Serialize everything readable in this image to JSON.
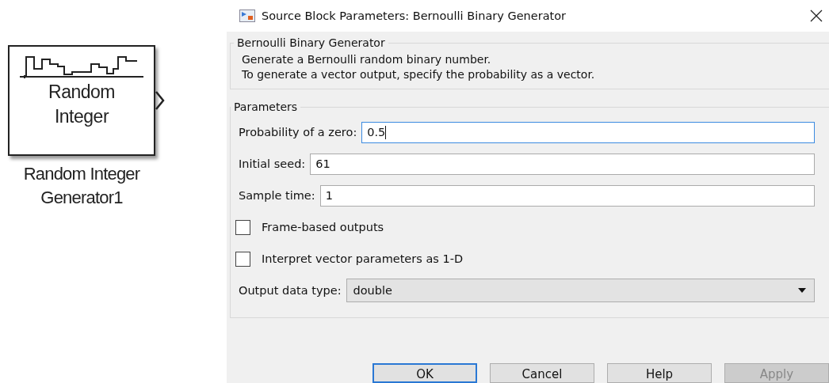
{
  "block": {
    "lines": [
      "Random",
      "Integer"
    ],
    "label_lines": [
      "Random Integer",
      "Generator1"
    ]
  },
  "window": {
    "title": "Source Block Parameters: Bernoulli Binary Generator"
  },
  "description": {
    "title": "Bernoulli Binary Generator",
    "lines": [
      "Generate a Bernoulli random binary number.",
      "To generate a vector output, specify the probability as a vector."
    ]
  },
  "parameters": {
    "title": "Parameters",
    "items": [
      {
        "kind": "text",
        "label": "Probability of a zero:",
        "value": "0.5",
        "focused": true
      },
      {
        "kind": "text",
        "label": "Initial seed:",
        "value": "61",
        "focused": false
      },
      {
        "kind": "text",
        "label": "Sample time:",
        "value": "1",
        "focused": false
      },
      {
        "kind": "checkbox",
        "label": "Frame-based outputs",
        "checked": false
      },
      {
        "kind": "checkbox",
        "label": "Interpret vector parameters as 1-D",
        "checked": false
      },
      {
        "kind": "dropdown",
        "label": "Output data type:",
        "value": "double"
      }
    ]
  },
  "buttons": [
    {
      "label": "OK",
      "default": true,
      "disabled": false
    },
    {
      "label": "Cancel",
      "default": false,
      "disabled": false
    },
    {
      "label": "Help",
      "default": false,
      "disabled": false
    },
    {
      "label": "Apply",
      "default": false,
      "disabled": true
    }
  ]
}
